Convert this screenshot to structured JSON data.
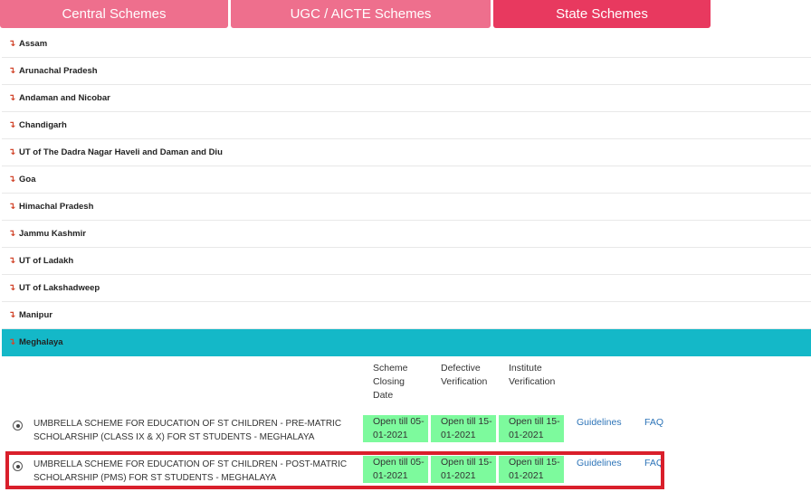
{
  "tabs": [
    {
      "label": "Central Schemes"
    },
    {
      "label": "UGC / AICTE Schemes"
    },
    {
      "label": "State Schemes"
    }
  ],
  "states": [
    {
      "label": "Assam"
    },
    {
      "label": "Arunachal Pradesh"
    },
    {
      "label": "Andaman and Nicobar"
    },
    {
      "label": "Chandigarh"
    },
    {
      "label": "UT of The Dadra Nagar Haveli and Daman and Diu"
    },
    {
      "label": "Goa"
    },
    {
      "label": "Himachal Pradesh"
    },
    {
      "label": "Jammu Kashmir"
    },
    {
      "label": "UT of Ladakh"
    },
    {
      "label": "UT of Lakshadweep"
    },
    {
      "label": "Manipur"
    },
    {
      "label": "Meghalaya"
    }
  ],
  "icons": {
    "state_arrow": "arrow-down-right-icon",
    "state_arrow_glyph": "↴"
  },
  "columns": {
    "closing": "Scheme Closing Date",
    "defective": "Defective Verification",
    "institute": "Institute Verification"
  },
  "schemes": [
    {
      "name": "UMBRELLA SCHEME FOR EDUCATION OF ST CHILDREN - PRE-MATRIC SCHOLARSHIP (CLASS IX & X) FOR ST STUDENTS - MEGHALAYA",
      "closing": "Open till 05-01-2021",
      "defective": "Open till 15-01-2021",
      "institute": "Open till 15-01-2021",
      "guidelines": "Guidelines",
      "faq": "FAQ"
    },
    {
      "name": "UMBRELLA SCHEME FOR EDUCATION OF ST CHILDREN - POST-MATRIC SCHOLARSHIP (PMS) FOR ST STUDENTS - MEGHALAYA",
      "closing": "Open till 05-01-2021",
      "defective": "Open till 15-01-2021",
      "institute": "Open till 15-01-2021",
      "guidelines": "Guidelines",
      "faq": "FAQ"
    }
  ],
  "colors": {
    "tab": "#ee6f8d",
    "tab_active": "#e8395f",
    "active_state": "#14b8c8",
    "badge": "#7dfa9d",
    "highlight": "#d91f2b"
  }
}
